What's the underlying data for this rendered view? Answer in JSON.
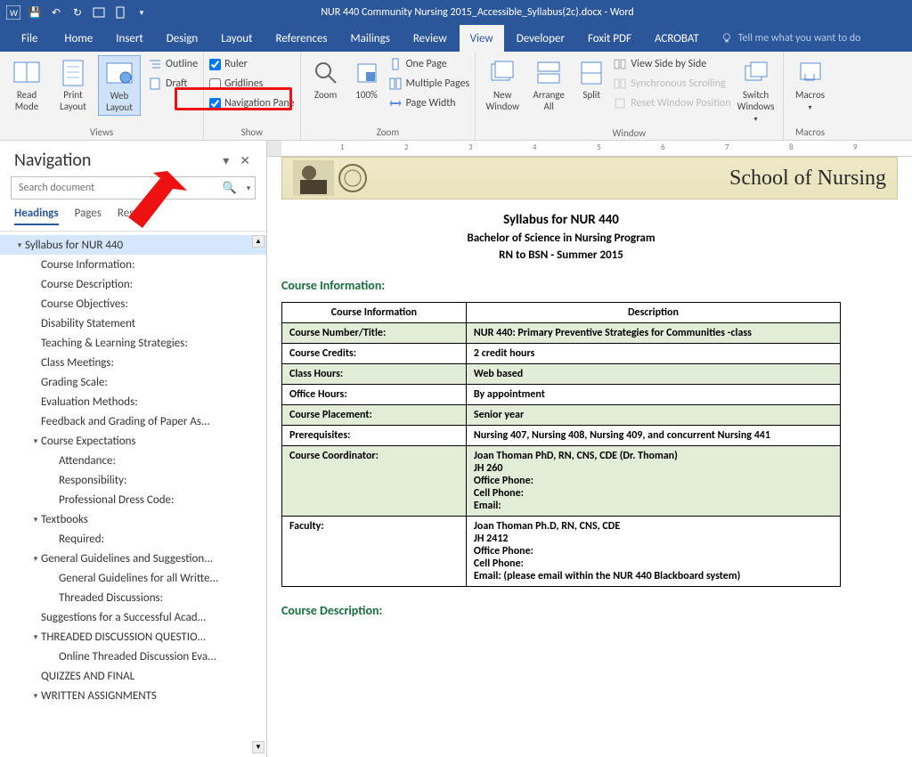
{
  "window": {
    "title": "NUR 440 Community Nursing 2015_Accessible_Syllabus(2c).docx - Word"
  },
  "tabs": {
    "file": "File",
    "home": "Home",
    "insert": "Insert",
    "design": "Design",
    "layout": "Layout",
    "references": "References",
    "mailings": "Mailings",
    "review": "Review",
    "view": "View",
    "developer": "Developer",
    "foxit": "Foxit PDF",
    "acrobat": "ACROBAT",
    "tellme": "Tell me what you want to do"
  },
  "ribbon": {
    "views": {
      "label": "Views",
      "read": "Read Mode",
      "print": "Print Layout",
      "web": "Web Layout",
      "outline": "Outline",
      "draft": "Draft"
    },
    "show": {
      "label": "Show",
      "ruler": "Ruler",
      "gridlines": "Gridlines",
      "navpane": "Navigation Pane"
    },
    "zoom": {
      "label": "Zoom",
      "zoom": "Zoom",
      "p100": "100%",
      "onepage": "One Page",
      "multipage": "Multiple Pages",
      "pagewidth": "Page Width"
    },
    "window": {
      "label": "Window",
      "neww": "New Window",
      "arrange": "Arrange All",
      "split": "Split",
      "sidebyside": "View Side by Side",
      "sync": "Synchronous Scrolling",
      "reset": "Reset Window Position",
      "switch": "Switch Windows"
    },
    "macros": {
      "label": "Macros",
      "macros": "Macros"
    }
  },
  "nav": {
    "title": "Navigation",
    "search_placeholder": "Search document",
    "tabs": {
      "headings": "Headings",
      "pages": "Pages",
      "results": "Results"
    },
    "items": [
      {
        "text": "Syllabus for NUR 440",
        "lvl": 0,
        "tw": "▾",
        "sel": true
      },
      {
        "text": "Course Information:",
        "lvl": 1
      },
      {
        "text": "Course Description:",
        "lvl": 1
      },
      {
        "text": "Course Objectives:",
        "lvl": 1
      },
      {
        "text": "Disability Statement",
        "lvl": 1
      },
      {
        "text": "Teaching & Learning Strategies:",
        "lvl": 1
      },
      {
        "text": "Class Meetings:",
        "lvl": 1
      },
      {
        "text": "Grading Scale:",
        "lvl": 1
      },
      {
        "text": "Evaluation Methods:",
        "lvl": 1
      },
      {
        "text": "Feedback and Grading of Paper As...",
        "lvl": 1
      },
      {
        "text": "Course Expectations",
        "lvl": 1,
        "tw": "▾"
      },
      {
        "text": "Attendance:",
        "lvl": 2
      },
      {
        "text": "Responsibility:",
        "lvl": 2
      },
      {
        "text": "Professional Dress Code:",
        "lvl": 2
      },
      {
        "text": "Textbooks",
        "lvl": 1,
        "tw": "▾"
      },
      {
        "text": "Required:",
        "lvl": 2
      },
      {
        "text": "General Guidelines and Suggestion...",
        "lvl": 1,
        "tw": "▾"
      },
      {
        "text": "General Guidelines for all Writte...",
        "lvl": 2
      },
      {
        "text": "Threaded Discussions:",
        "lvl": 2
      },
      {
        "text": "Suggestions for a Successful Acad...",
        "lvl": 1
      },
      {
        "text": "THREADED DISCUSSION QUESTIO...",
        "lvl": 1,
        "tw": "▾"
      },
      {
        "text": "Online Threaded Discussion Eva...",
        "lvl": 2
      },
      {
        "text": "QUIZZES AND FINAL",
        "lvl": 1
      },
      {
        "text": "WRITTEN ASSIGNMENTS",
        "lvl": 1,
        "tw": "▾"
      }
    ]
  },
  "doc": {
    "banner": "School of Nursing",
    "h1": "Syllabus for NUR 440",
    "h2": "Bachelor of Science in Nursing Program",
    "h3": "RN to BSN  -  Summer 2015",
    "sec1": "Course Information:",
    "cols": {
      "c1": "Course Information",
      "c2": "Description"
    },
    "rows": [
      {
        "k": "Course Number/Title:",
        "v": "NUR 440: Primary Preventive Strategies for Communities -class",
        "g": true
      },
      {
        "k": "Course Credits:",
        "v": "2 credit hours"
      },
      {
        "k": "Class Hours:",
        "v": "Web based",
        "g": true
      },
      {
        "k": "Office Hours:",
        "v": "By appointment"
      },
      {
        "k": "Course Placement:",
        "v": "Senior year",
        "g": true
      },
      {
        "k": "Prerequisites:",
        "v": "Nursing 407, Nursing 408, Nursing 409, and concurrent Nursing 441"
      },
      {
        "k": "Course Coordinator:",
        "v": "Joan Thoman PhD, RN, CNS, CDE (Dr. Thoman)\nJH 260\nOffice Phone:\nCell Phone:\nEmail:",
        "g": true
      },
      {
        "k": "Faculty:",
        "v": "Joan Thoman Ph.D, RN, CNS, CDE\nJH 2412\nOffice Phone:\nCell Phone:\nEmail:                               (please email within the NUR 440 Blackboard system)"
      }
    ],
    "sec2": "Course Description:"
  }
}
